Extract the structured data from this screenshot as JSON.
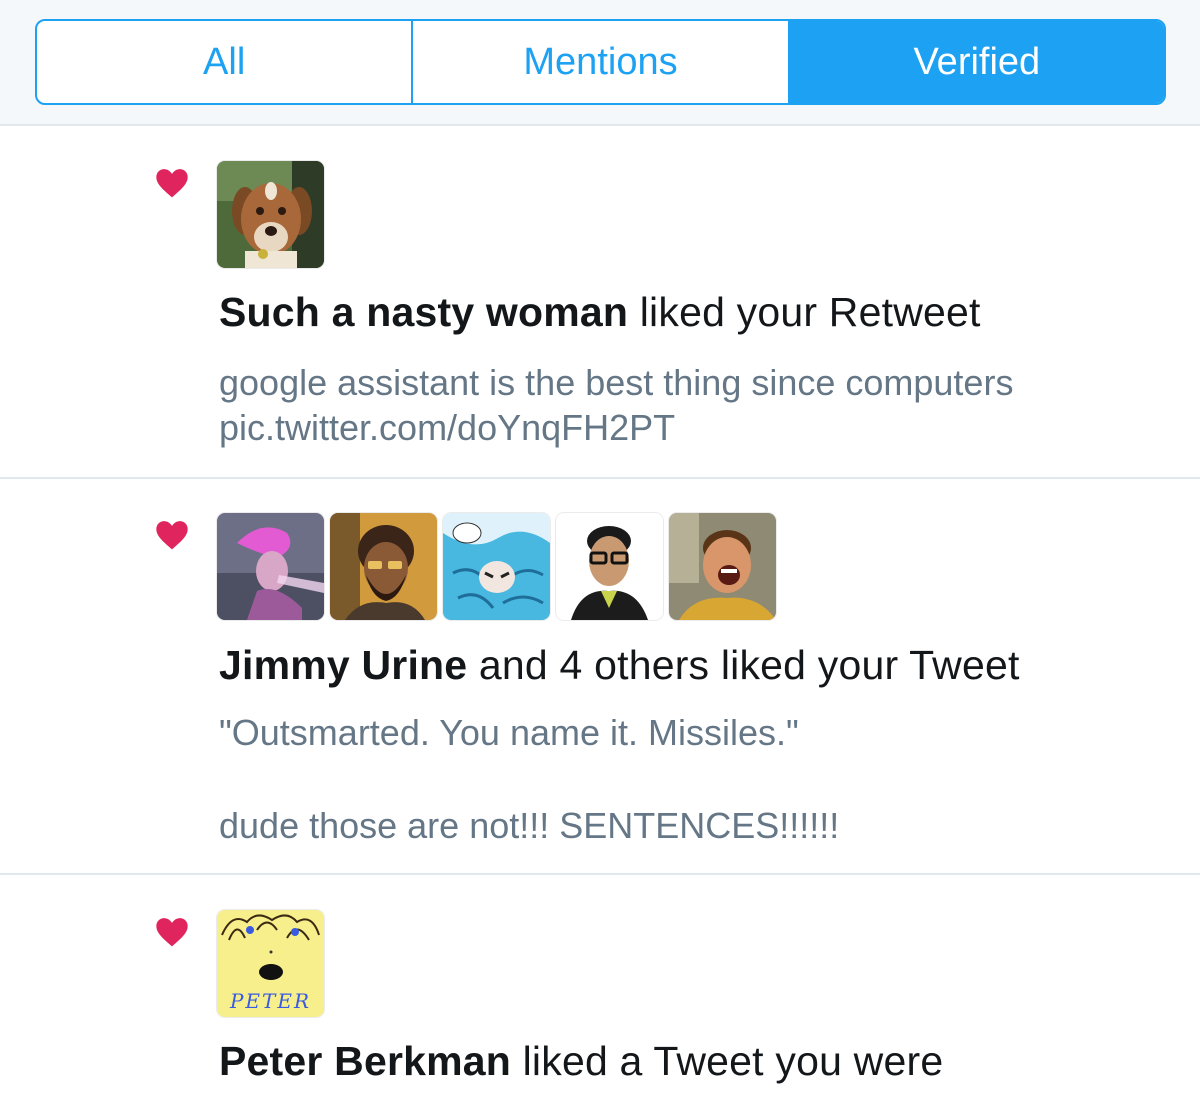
{
  "tabs": [
    {
      "label": "All",
      "active": false
    },
    {
      "label": "Mentions",
      "active": false
    },
    {
      "label": "Verified",
      "active": true
    }
  ],
  "colors": {
    "accent": "#1da1f2",
    "heart": "#e0245e",
    "secondary_text": "#657786"
  },
  "notifications": [
    {
      "icon": "heart-icon",
      "actor": "Such a nasty woman",
      "action": " liked your Retweet",
      "snippet_lines": [
        "google assistant is the best thing since computers",
        "pic.twitter.com/doYnqFH2PT"
      ]
    },
    {
      "icon": "heart-icon",
      "actor": "Jimmy Urine",
      "action": " and 4 others liked your Tweet",
      "snippet_lines": [
        "\"Outsmarted. You name it. Missiles.\"",
        "dude those are not!!! SENTENCES!!!!!!"
      ]
    },
    {
      "icon": "heart-icon",
      "actor": "Peter Berkman",
      "action": " liked a Tweet you were",
      "avatar_text": "PETER"
    }
  ]
}
